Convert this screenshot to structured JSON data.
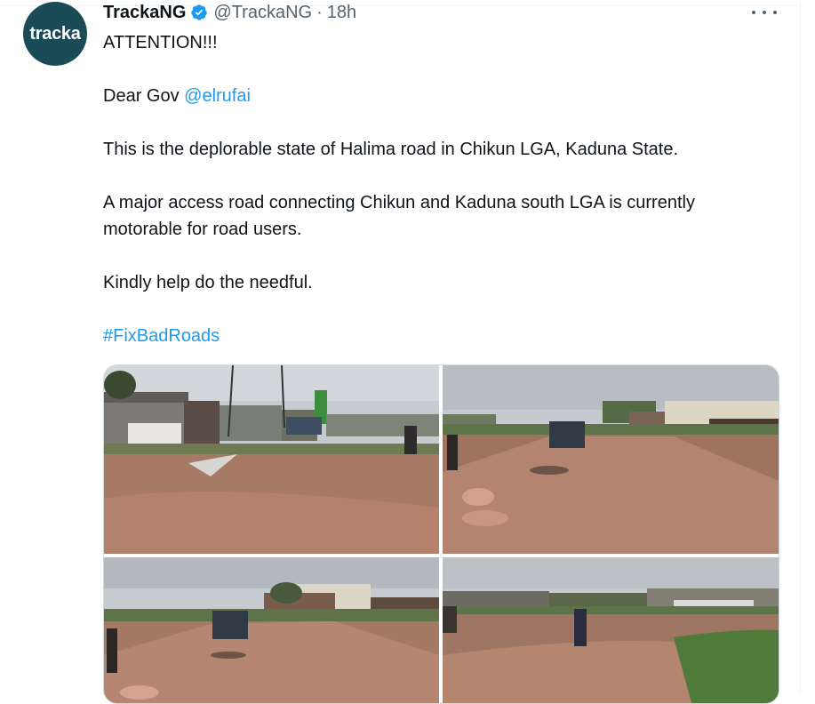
{
  "tweet": {
    "avatar_text": "tracka",
    "display_name": "TrackaNG",
    "handle": "@TrackaNG",
    "separator": "·",
    "time": "18h",
    "line1": "ATTENTION!!!",
    "dear_prefix": "Dear Gov ",
    "mention": "@elrufai",
    "line3": "This is the deplorable state of Halima road in Chikun LGA, Kaduna State.",
    "line4a": "A major access road connecting  Chikun and Kaduna south LGA is currently",
    "line4b": "motorable for road users.",
    "line5": "Kindly help do the needful.",
    "hashtag": "#FixBadRoads"
  },
  "colors": {
    "link": "#1d9bf0",
    "verified": "#1d9bf0",
    "avatar_bg": "#1b4b57",
    "muddy_water": "#a07563",
    "sky": "#c9cdd2"
  },
  "icons": {
    "verified": "verified-badge-icon",
    "more": "more-dots-icon"
  },
  "media": {
    "photos": [
      {
        "name": "photo-1"
      },
      {
        "name": "photo-2"
      },
      {
        "name": "photo-3"
      },
      {
        "name": "photo-4"
      }
    ]
  }
}
